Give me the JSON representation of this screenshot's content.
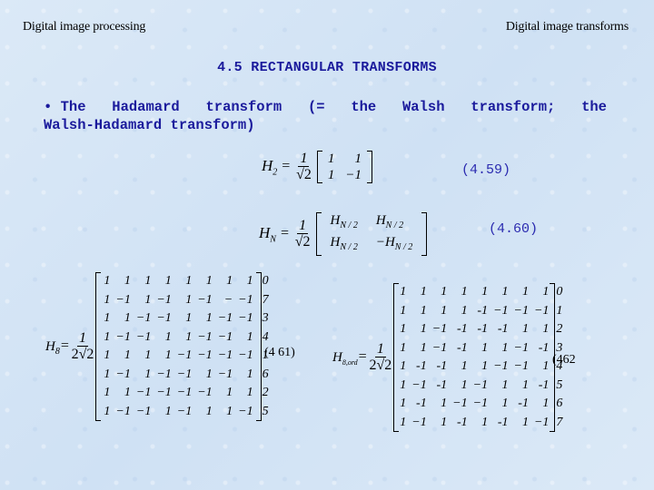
{
  "header": {
    "left": "Digital image processing",
    "right": "Digital image transforms"
  },
  "title": "4.5 RECTANGULAR TRANSFORMS",
  "bullet": {
    "line1_words": [
      "• The",
      "Hadamard",
      "transform",
      "(=",
      "the",
      "Walsh",
      "transform;",
      "the"
    ],
    "line2": "Walsh-Hadamard transform)"
  },
  "eq459": {
    "lhs": "H",
    "lhs_sub": "2",
    "equals": "=",
    "frac_num": "1",
    "frac_den": "√2",
    "matrix": [
      [
        "1",
        "1"
      ],
      [
        "1",
        "−1"
      ]
    ],
    "number": "(4.59)"
  },
  "eq460": {
    "lhs": "H",
    "lhs_sub": "N",
    "equals": "=",
    "frac_num": "1",
    "frac_den": "√2",
    "matrix": [
      [
        {
          "t": "H",
          "s": "N / 2"
        },
        {
          "t": "H",
          "s": "N / 2"
        }
      ],
      [
        {
          "t": "H",
          "s": "N / 2"
        },
        {
          "t": "−H",
          "s": "N / 2"
        }
      ]
    ],
    "number": "(4.60)"
  },
  "eq461": {
    "lhs": "H",
    "lhs_sub": "8",
    "equals": "=",
    "frac_num": "1",
    "frac_den": "2√2",
    "matrix": [
      [
        "1",
        "1",
        "1",
        "1",
        "1",
        "1",
        "1",
        "1"
      ],
      [
        "1",
        "−1",
        "1",
        "−1",
        "1",
        "−1",
        "−",
        "−1"
      ],
      [
        "1",
        "1",
        "−1",
        "−1",
        "1",
        "1",
        "−1",
        "−1"
      ],
      [
        "1",
        "−1",
        "−1",
        "1",
        "1",
        "−1",
        "−1",
        "1"
      ],
      [
        "1",
        "1",
        "1",
        "1",
        "−1",
        "−1",
        "−1",
        "−1"
      ],
      [
        "1",
        "−1",
        "1",
        "−1",
        "−1",
        "1",
        "−1",
        "1"
      ],
      [
        "1",
        "1",
        "−1",
        "−1",
        "−1",
        "−1",
        "1",
        "1"
      ],
      [
        "1",
        "−1",
        "−1",
        "1",
        "−1",
        "1",
        "1",
        "−1"
      ]
    ],
    "row_indices": [
      "0",
      "7",
      "3",
      "4",
      "1",
      "6",
      "2",
      "5"
    ],
    "number": "(4 61)"
  },
  "eq462": {
    "lhs": "H",
    "lhs_sub": "8,ord",
    "equals": "=",
    "frac_num": "1",
    "frac_den": "2√2",
    "matrix": [
      [
        "1",
        "1",
        "1",
        "1",
        "1",
        "1",
        "1",
        "1"
      ],
      [
        "1",
        "1",
        "1",
        "1",
        "-1",
        "−1",
        "−1",
        "−1"
      ],
      [
        "1",
        "1",
        "−1",
        "-1",
        "-1",
        "-1",
        "1",
        "1"
      ],
      [
        "1",
        "1",
        "−1",
        "-1",
        "1",
        "1",
        "−1",
        "-1"
      ],
      [
        "1",
        "-1",
        "-1",
        "1",
        "1",
        "−1",
        "−1",
        "1"
      ],
      [
        "1",
        "−1",
        "-1",
        "1",
        "−1",
        "1",
        "1",
        "-1"
      ],
      [
        "1",
        "-1",
        "1",
        "−1",
        "−1",
        "1",
        "-1",
        "1"
      ],
      [
        "1",
        "−1",
        "1",
        "-1",
        "1",
        "-1",
        "1",
        "−1"
      ]
    ],
    "row_indices": [
      "0",
      "1",
      "2",
      "3",
      "4",
      "5",
      "6",
      "7"
    ],
    "number": "(462"
  }
}
